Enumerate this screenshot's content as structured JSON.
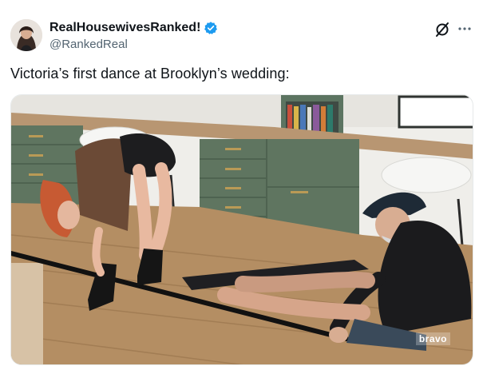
{
  "author": {
    "display_name": "RealHousewivesRanked!",
    "handle": "@RankedReal",
    "verified": true,
    "verified_color": "#1d9bf0"
  },
  "tweet": {
    "text": "Victoria’s first dance at Brooklyn’s wedding:"
  },
  "media": {
    "type": "image",
    "watermark": "bravo"
  },
  "icons": {
    "grok": "grok-icon",
    "more": "more-options-icon",
    "verified": "verified-badge-icon"
  },
  "colors": {
    "text_primary": "#0f1419",
    "text_secondary": "#536471",
    "cabinet_green": "#5f7560",
    "floor_wood": "#b48e63"
  }
}
